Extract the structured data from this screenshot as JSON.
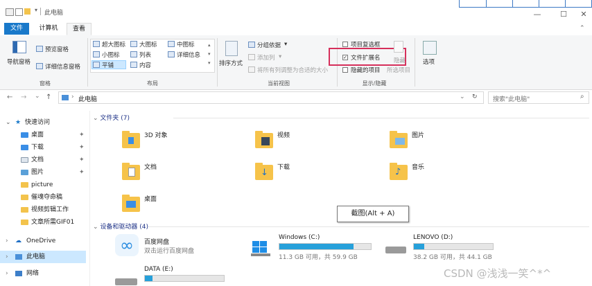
{
  "window": {
    "address_path": "此电脑",
    "search_placeholder": "搜索\"此电脑\""
  },
  "title": {
    "text": "此电脑"
  },
  "tabs": [
    {
      "label": "文件"
    },
    {
      "label": "计算机"
    },
    {
      "label": "查看"
    }
  ],
  "ribbon": {
    "pane": {
      "nav_pane": "导航窗格",
      "preview_pane": "预览窗格",
      "details_pane": "详细信息窗格",
      "group": "窗格"
    },
    "layout": {
      "xl_icons": "超大图标",
      "l_icons": "大图标",
      "m_icons": "中图标",
      "s_icons": "小图标",
      "list": "列表",
      "details": "详细信息",
      "tiles": "平铺",
      "content": "内容",
      "group": "布局"
    },
    "current_view": {
      "sort": "排序方式",
      "group_by": "分组依据",
      "add_col": "添加列",
      "fit_cols": "将所有列调整为合适的大小",
      "group": "当前视图"
    },
    "show_hide": {
      "item_checkbox": "项目复选框",
      "file_ext": "文件扩展名",
      "hidden_items": "隐藏的项目",
      "hide": "隐藏",
      "hide_selected": "所选项目",
      "group": "显示/隐藏"
    },
    "options": "选项"
  },
  "nav": {
    "quick_access": "快速访问",
    "items": [
      {
        "label": "桌面"
      },
      {
        "label": "下载"
      },
      {
        "label": "文档"
      },
      {
        "label": "图片"
      },
      {
        "label": "picture"
      },
      {
        "label": "催魂夺命稿"
      },
      {
        "label": "视频剪辑工作"
      },
      {
        "label": "文章所需GIF01"
      }
    ],
    "onedrive": "OneDrive",
    "this_pc": "此电脑",
    "network": "网络"
  },
  "content": {
    "folders_header": "文件夹 (7)",
    "folders": [
      {
        "name": "3D 对象"
      },
      {
        "name": "视频"
      },
      {
        "name": "图片"
      },
      {
        "name": "文档"
      },
      {
        "name": "下载"
      },
      {
        "name": "音乐"
      },
      {
        "name": "桌面"
      }
    ],
    "drives_header": "设备和驱动器 (4)",
    "baidu": {
      "name": "百度网盘",
      "sub": "双击运行百度网盘"
    },
    "drives": [
      {
        "name": "Windows (C:)",
        "info": "11.3 GB 可用，共 59.9 GB",
        "used_fraction": 0.81
      },
      {
        "name": "LENOVO (D:)",
        "info": "38.2 GB 可用，共 44.1 GB",
        "used_fraction": 0.13
      },
      {
        "name": "DATA (E:)",
        "info": "",
        "used_fraction": 0.1
      }
    ]
  },
  "tooltip": {
    "text": "截图(Alt + A)"
  },
  "watermark": {
    "text": "CSDN @浅浅一笑^*^"
  },
  "colors": {
    "accent": "#1979ca",
    "highlight_box": "#d62f5b",
    "drive_bar": "#26a0da"
  }
}
